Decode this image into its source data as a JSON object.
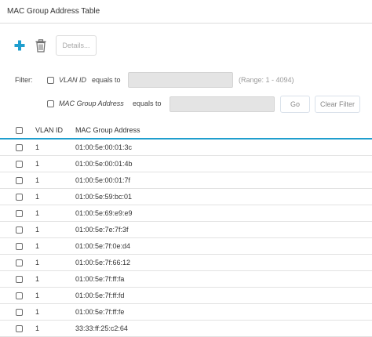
{
  "header": {
    "title": "MAC Group Address Table"
  },
  "toolbar": {
    "add_icon": "plus-icon",
    "delete_icon": "trash-icon",
    "details_label": "Details...",
    "accent_color": "#1f9ece"
  },
  "filter": {
    "label": "Filter:",
    "vlan": {
      "field_label": "VLAN ID",
      "operator": "equals to",
      "value": "",
      "range_hint": "(Range: 1 - 4094)"
    },
    "mac": {
      "field_label": "MAC Group Address",
      "operator": "equals to",
      "value": ""
    },
    "go_label": "Go",
    "clear_label": "Clear Filter"
  },
  "table": {
    "columns": [
      "VLAN ID",
      "MAC Group Address"
    ],
    "rows": [
      {
        "vlan": "1",
        "mac": "01:00:5e:00:01:3c"
      },
      {
        "vlan": "1",
        "mac": "01:00:5e:00:01:4b"
      },
      {
        "vlan": "1",
        "mac": "01:00:5e:00:01:7f"
      },
      {
        "vlan": "1",
        "mac": "01:00:5e:59:bc:01"
      },
      {
        "vlan": "1",
        "mac": "01:00:5e:69:e9:e9"
      },
      {
        "vlan": "1",
        "mac": "01:00:5e:7e:7f:3f"
      },
      {
        "vlan": "1",
        "mac": "01:00:5e:7f:0e:d4"
      },
      {
        "vlan": "1",
        "mac": "01:00:5e:7f:66:12"
      },
      {
        "vlan": "1",
        "mac": "01:00:5e:7f:ff:fa"
      },
      {
        "vlan": "1",
        "mac": "01:00:5e:7f:ff:fd"
      },
      {
        "vlan": "1",
        "mac": "01:00:5e:7f:ff:fe"
      },
      {
        "vlan": "1",
        "mac": "33:33:ff:25:c2:64"
      }
    ]
  }
}
